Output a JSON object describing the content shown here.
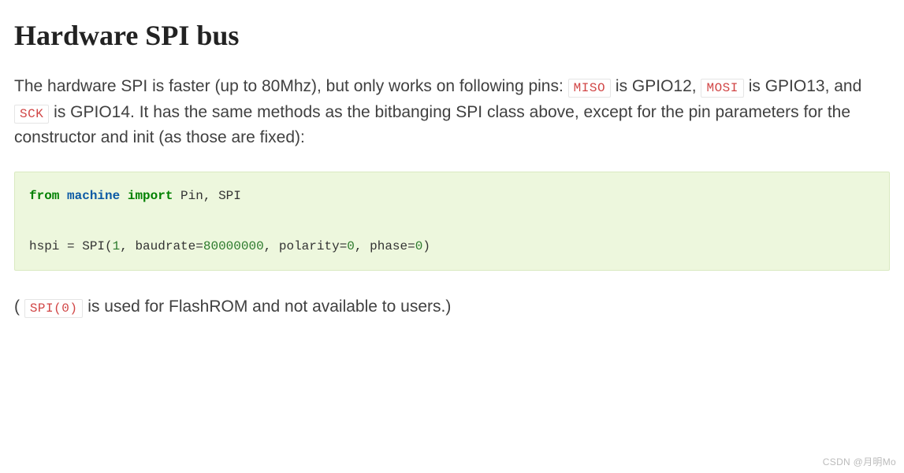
{
  "heading": "Hardware SPI bus",
  "para1": {
    "t1": "The hardware SPI is faster (up to 80Mhz), but only works on following pins: ",
    "code1": "MISO",
    "t2": " is GPIO12, ",
    "code2": "MOSI",
    "t3": " is GPIO13, and ",
    "code3": "SCK",
    "t4": " is GPIO14. It has the same methods as the bitbanging SPI class above, except for the pin parameters for the constructor and init (as those are fixed):"
  },
  "code": {
    "kw_from": "from",
    "mod": "machine",
    "kw_import": "import",
    "imports": " Pin, SPI",
    "line2_a": "hspi = SPI(",
    "n1": "1",
    "line2_b": ", baudrate=",
    "n2": "80000000",
    "line2_c": ", polarity=",
    "n3": "0",
    "line2_d": ", phase=",
    "n4": "0",
    "line2_e": ")"
  },
  "para2": {
    "t1": "( ",
    "code1": "SPI(0)",
    "t2": " is used for FlashROM and not available to users.)"
  },
  "watermark": "CSDN @月明Mo"
}
